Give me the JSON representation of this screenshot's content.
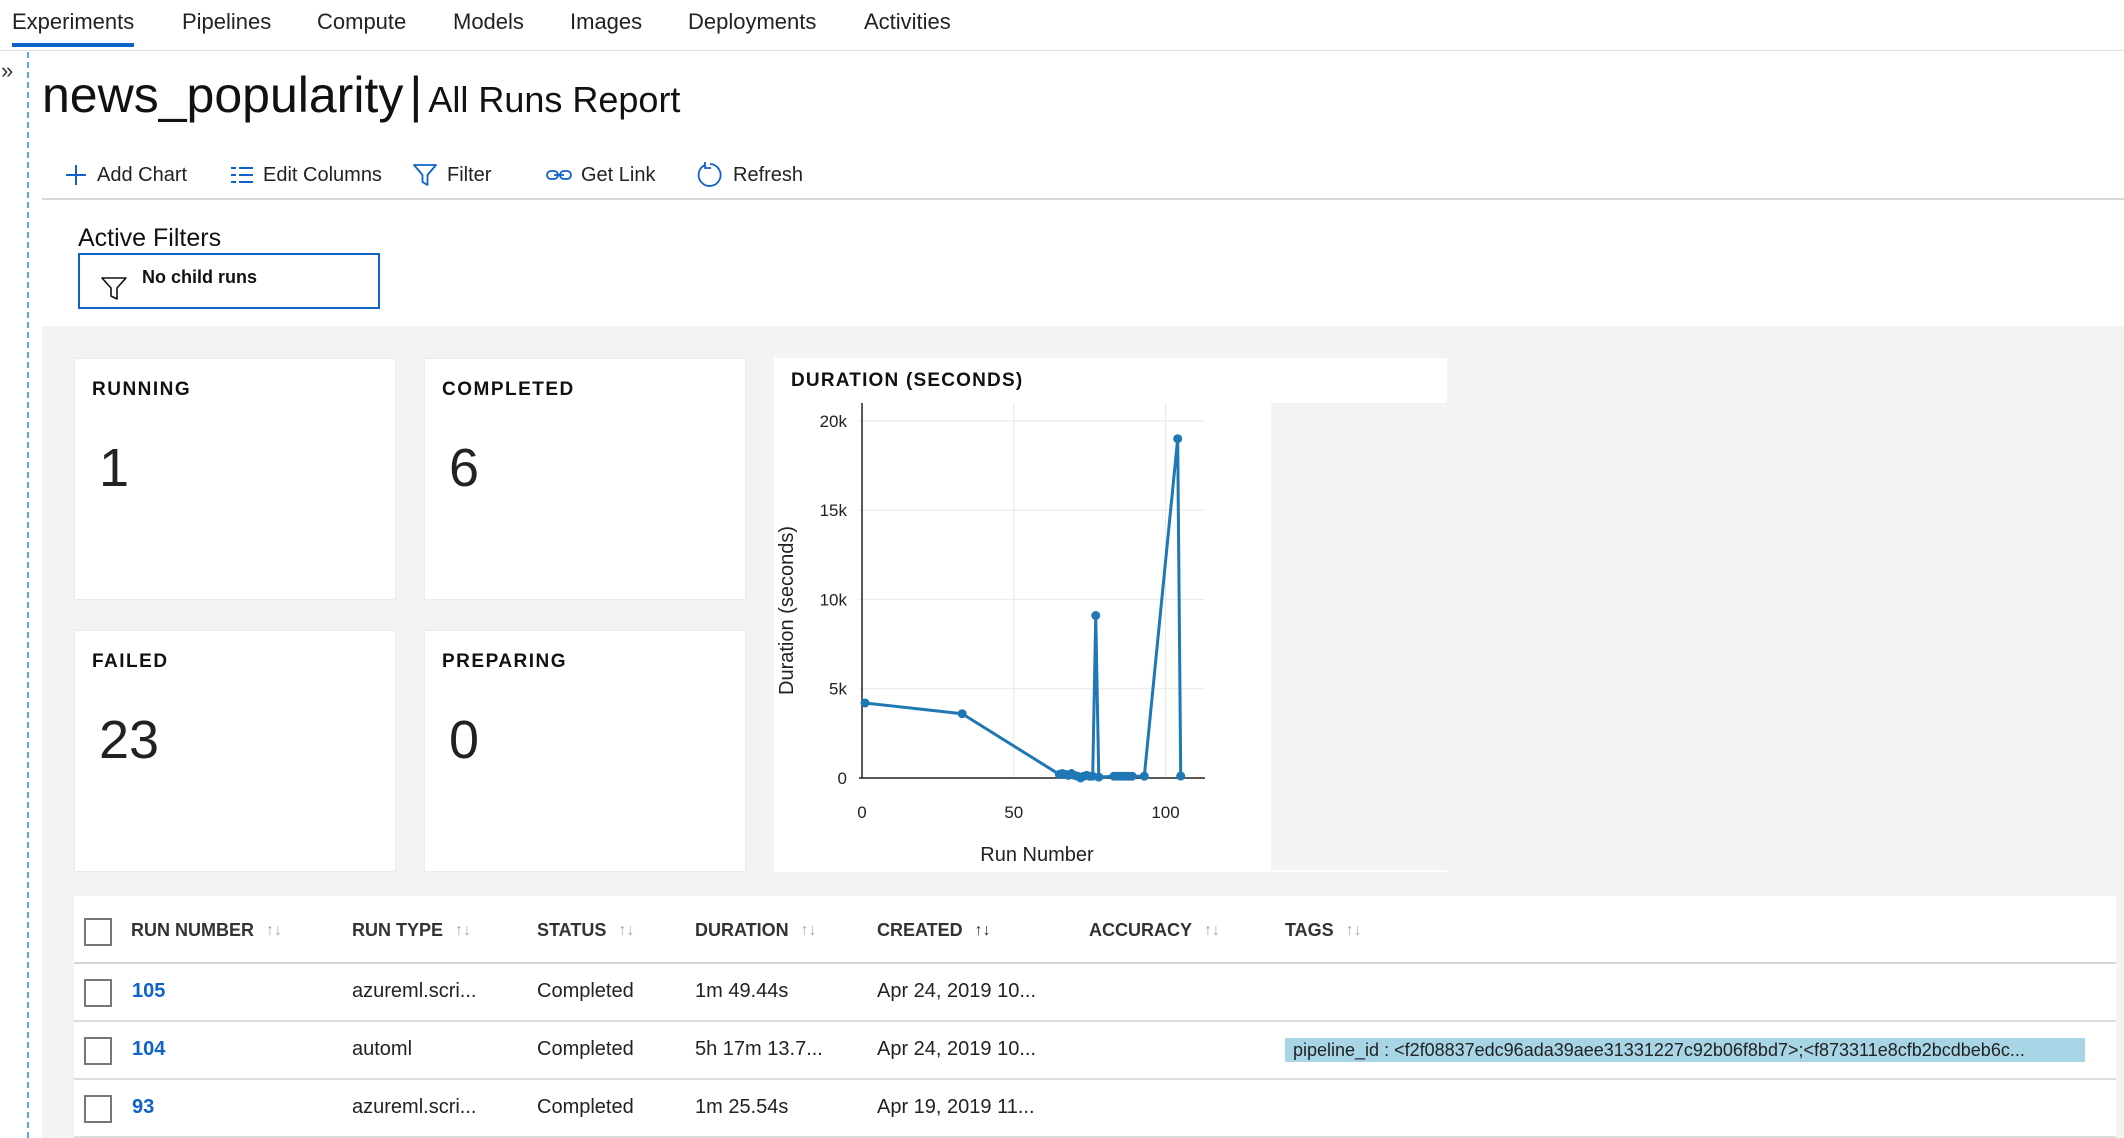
{
  "nav": {
    "tabs": [
      {
        "label": "Experiments",
        "active": true
      },
      {
        "label": "Pipelines"
      },
      {
        "label": "Compute"
      },
      {
        "label": "Models"
      },
      {
        "label": "Images"
      },
      {
        "label": "Deployments"
      },
      {
        "label": "Activities"
      }
    ],
    "expander_glyph": "»"
  },
  "header": {
    "experiment": "news_popularity",
    "separator": "|",
    "report": "All Runs Report"
  },
  "toolbar": {
    "add_chart": "Add Chart",
    "edit_columns": "Edit Columns",
    "filter": "Filter",
    "get_link": "Get Link",
    "refresh": "Refresh"
  },
  "filters": {
    "heading": "Active Filters",
    "chip": "No child runs"
  },
  "stats": {
    "running": {
      "label": "RUNNING",
      "value": "1"
    },
    "completed": {
      "label": "COMPLETED",
      "value": "6"
    },
    "failed": {
      "label": "FAILED",
      "value": "23"
    },
    "preparing": {
      "label": "PREPARING",
      "value": "0"
    }
  },
  "chart_data": {
    "type": "line",
    "title": "DURATION (SECONDS)",
    "xlabel": "Run Number",
    "ylabel": "Duration (seconds)",
    "xlim": [
      -1,
      113
    ],
    "ylim": [
      0,
      21000
    ],
    "xticks": [
      0,
      50,
      100
    ],
    "xtick_labels": [
      "0",
      "50",
      "100"
    ],
    "yticks": [
      0,
      5000,
      10000,
      15000,
      20000
    ],
    "ytick_labels": [
      "0",
      "5k",
      "10k",
      "15k",
      "20k"
    ],
    "grid": true,
    "series": [
      {
        "color": "#1f77b4",
        "x": [
          1,
          33,
          65,
          66,
          67,
          68,
          69,
          70,
          71,
          72,
          73,
          74,
          75,
          76,
          77,
          78,
          83,
          84,
          85,
          86,
          87,
          88,
          89,
          93,
          104,
          105
        ],
        "y": [
          4200,
          3600,
          200,
          250,
          200,
          150,
          250,
          150,
          100,
          0,
          100,
          150,
          100,
          100,
          9100,
          50,
          100,
          100,
          100,
          100,
          100,
          100,
          100,
          100,
          19000,
          109
        ]
      }
    ]
  },
  "table": {
    "columns": [
      "RUN NUMBER",
      "RUN TYPE",
      "STATUS",
      "DURATION",
      "CREATED",
      "ACCURACY",
      "TAGS"
    ],
    "rows": [
      {
        "run": "105",
        "type": "azureml.scri...",
        "status": "Completed",
        "duration": "1m 49.44s",
        "created": "Apr 24, 2019 10...",
        "accuracy": "",
        "tags": ""
      },
      {
        "run": "104",
        "type": "automl",
        "status": "Completed",
        "duration": "5h 17m 13.7...",
        "created": "Apr 24, 2019 10...",
        "accuracy": "",
        "tags": "pipeline_id : <f2f08837edc96ada39aee31331227c92b06f8bd7>;<f873311e8cfb2bcdbeb6c..."
      },
      {
        "run": "93",
        "type": "azureml.scri...",
        "status": "Completed",
        "duration": "1m 25.54s",
        "created": "Apr 19, 2019 11...",
        "accuracy": "",
        "tags": ""
      }
    ]
  }
}
